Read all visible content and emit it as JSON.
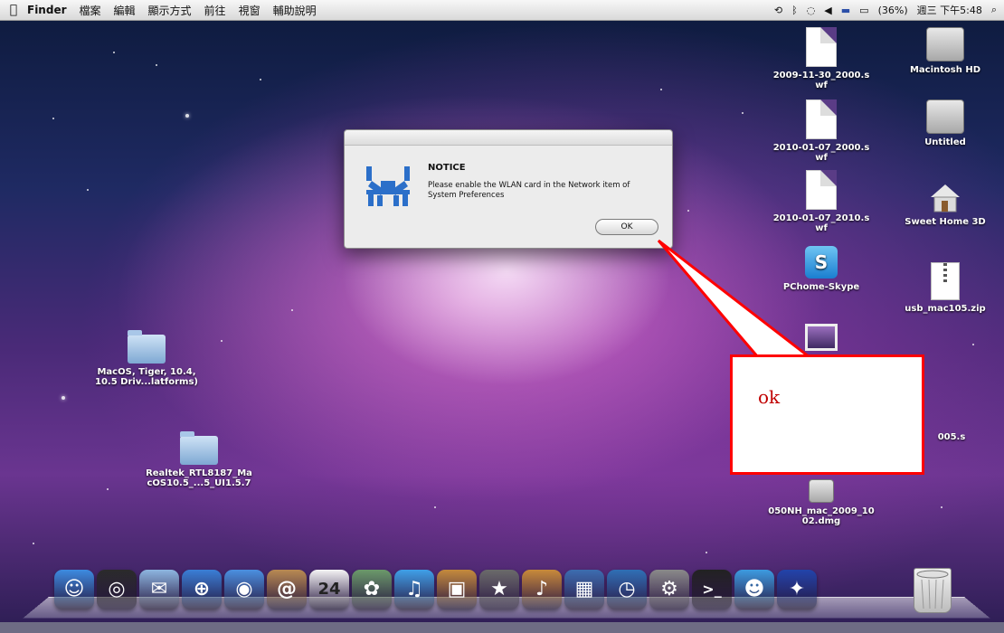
{
  "menubar": {
    "apple": "",
    "app_name": "Finder",
    "menus": [
      "檔案",
      "編輯",
      "顯示方式",
      "前往",
      "視窗",
      "輔助說明"
    ],
    "battery": "(36%)",
    "clock": "週三 下午5:48",
    "icons": [
      "time-machine-icon",
      "bluetooth-icon",
      "wifi-icon",
      "volume-icon",
      "flag-icon",
      "battery-icon",
      "spotlight-icon"
    ]
  },
  "desktop_icons": [
    {
      "name": "2009-11-30_2000.swf",
      "label": "2009-11-30_2000.s\nwf",
      "icon": "document-icon"
    },
    {
      "name": "Macintosh HD",
      "label": "Macintosh HD",
      "icon": "hard-disk-icon"
    },
    {
      "name": "2010-01-07_2000.swf",
      "label": "2010-01-07_2000.s\nwf",
      "icon": "document-icon"
    },
    {
      "name": "Untitled",
      "label": "Untitled",
      "icon": "hard-disk-icon"
    },
    {
      "name": "2010-01-07_2010.swf",
      "label": "2010-01-07_2010.s\nwf",
      "icon": "document-icon"
    },
    {
      "name": "Sweet Home 3D",
      "label": "Sweet Home 3D",
      "icon": "house-icon"
    },
    {
      "name": "PChome-Skype",
      "label": "PChome-Skype",
      "icon": "skype-icon"
    },
    {
      "name": "usb_mac105.zip",
      "label": "usb_mac105.zip",
      "icon": "zip-icon"
    },
    {
      "name": "screenshot",
      "label": "",
      "icon": "screenshot-icon"
    },
    {
      "name": "partial-file",
      "label": "005.s",
      "icon": "document-icon"
    },
    {
      "name": "050NH_mac_2009_1002.dmg",
      "label": "050NH_mac_2009_10\n02.dmg",
      "icon": "disk-image-icon"
    },
    {
      "name": "MacOS, Tiger, 10.4, 10.5 Driv...latforms)",
      "label": "MacOS, Tiger, 10.4,\n10.5 Driv...latforms)",
      "icon": "folder-icon"
    },
    {
      "name": "Realtek_RTL8187_MacOS10.5_...5_UI1.5.7",
      "label": "Realtek_RTL8187_Ma\ncOS10.5_...5_UI1.5.7",
      "icon": "folder-icon"
    }
  ],
  "dialog": {
    "title": "NOTICE",
    "message": "Please enable the WLAN card in the Network item of System Preferences",
    "ok_label": "OK",
    "logo": "realtek-crab-logo"
  },
  "callout": {
    "text": "ok",
    "border_color": "#ff0000"
  },
  "dock": {
    "apps": [
      {
        "name": "Finder",
        "icon": "finder-icon",
        "color": "#3d8be0",
        "glyph": "☺"
      },
      {
        "name": "Dashboard",
        "icon": "dashboard-icon",
        "color": "#2b2b2b",
        "glyph": "◎"
      },
      {
        "name": "Mail",
        "icon": "mail-icon",
        "color": "#8db6e0",
        "glyph": "✉"
      },
      {
        "name": "Safari",
        "icon": "safari-icon",
        "color": "#3a7fd6",
        "glyph": "⊕"
      },
      {
        "name": "iChat",
        "icon": "ichat-icon",
        "color": "#4b90e0",
        "glyph": "◉"
      },
      {
        "name": "Address Book",
        "icon": "address-book-icon",
        "color": "#b98a52",
        "glyph": "@"
      },
      {
        "name": "iCal",
        "icon": "ical-icon",
        "color": "#f4f4f4",
        "glyph": "24"
      },
      {
        "name": "Preview",
        "icon": "preview-icon",
        "color": "#6b9a6a",
        "glyph": "✿"
      },
      {
        "name": "iTunes",
        "icon": "itunes-icon",
        "color": "#3fa0e8",
        "glyph": "♫"
      },
      {
        "name": "iPhoto",
        "icon": "iphoto-icon",
        "color": "#c48a3c",
        "glyph": "▣"
      },
      {
        "name": "iMovie",
        "icon": "imovie-icon",
        "color": "#6a6a6a",
        "glyph": "★"
      },
      {
        "name": "GarageBand",
        "icon": "garageband-icon",
        "color": "#c88a3a",
        "glyph": "♪"
      },
      {
        "name": "Spaces",
        "icon": "spaces-icon",
        "color": "#3c6db0",
        "glyph": "▦"
      },
      {
        "name": "Time Machine",
        "icon": "time-machine-icon",
        "color": "#2f6fb5",
        "glyph": "◷"
      },
      {
        "name": "System Preferences",
        "icon": "system-preferences-icon",
        "color": "#8a8a8a",
        "glyph": "⚙"
      },
      {
        "name": "Terminal",
        "icon": "terminal-icon",
        "color": "#222222",
        "glyph": ">_"
      },
      {
        "name": "MSN Messenger",
        "icon": "messenger-icon",
        "color": "#3c9be0",
        "glyph": "☻"
      },
      {
        "name": "Realtek Wireless Utility",
        "icon": "realtek-icon",
        "color": "#2244aa",
        "glyph": "✦"
      }
    ],
    "trash": {
      "name": "Trash",
      "icon": "trash-icon"
    }
  }
}
